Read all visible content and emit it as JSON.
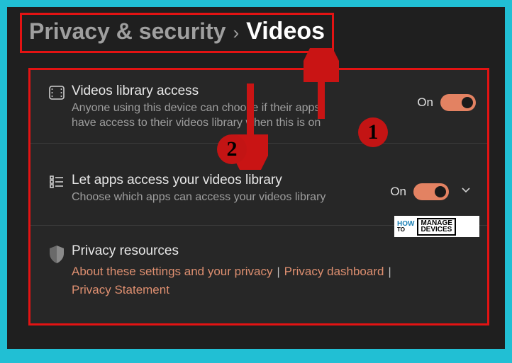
{
  "breadcrumb": {
    "parent": "Privacy & security",
    "separator": "›",
    "current": "Videos"
  },
  "rows": {
    "access": {
      "title": "Videos library access",
      "desc": "Anyone using this device can choose if their apps have access to their videos library when this is on",
      "state": "On"
    },
    "apps": {
      "title": "Let apps access your videos library",
      "desc": "Choose which apps can access your videos library",
      "state": "On"
    },
    "resources": {
      "title": "Privacy resources",
      "link1": "About these settings and your privacy",
      "link2": "Privacy dashboard",
      "link3": "Privacy Statement"
    }
  },
  "annotations": {
    "num1": "1",
    "num2": "2"
  },
  "watermark": {
    "how": "HOW",
    "to": "TO",
    "manage": "MANAGE",
    "devices": "DEVICES"
  }
}
